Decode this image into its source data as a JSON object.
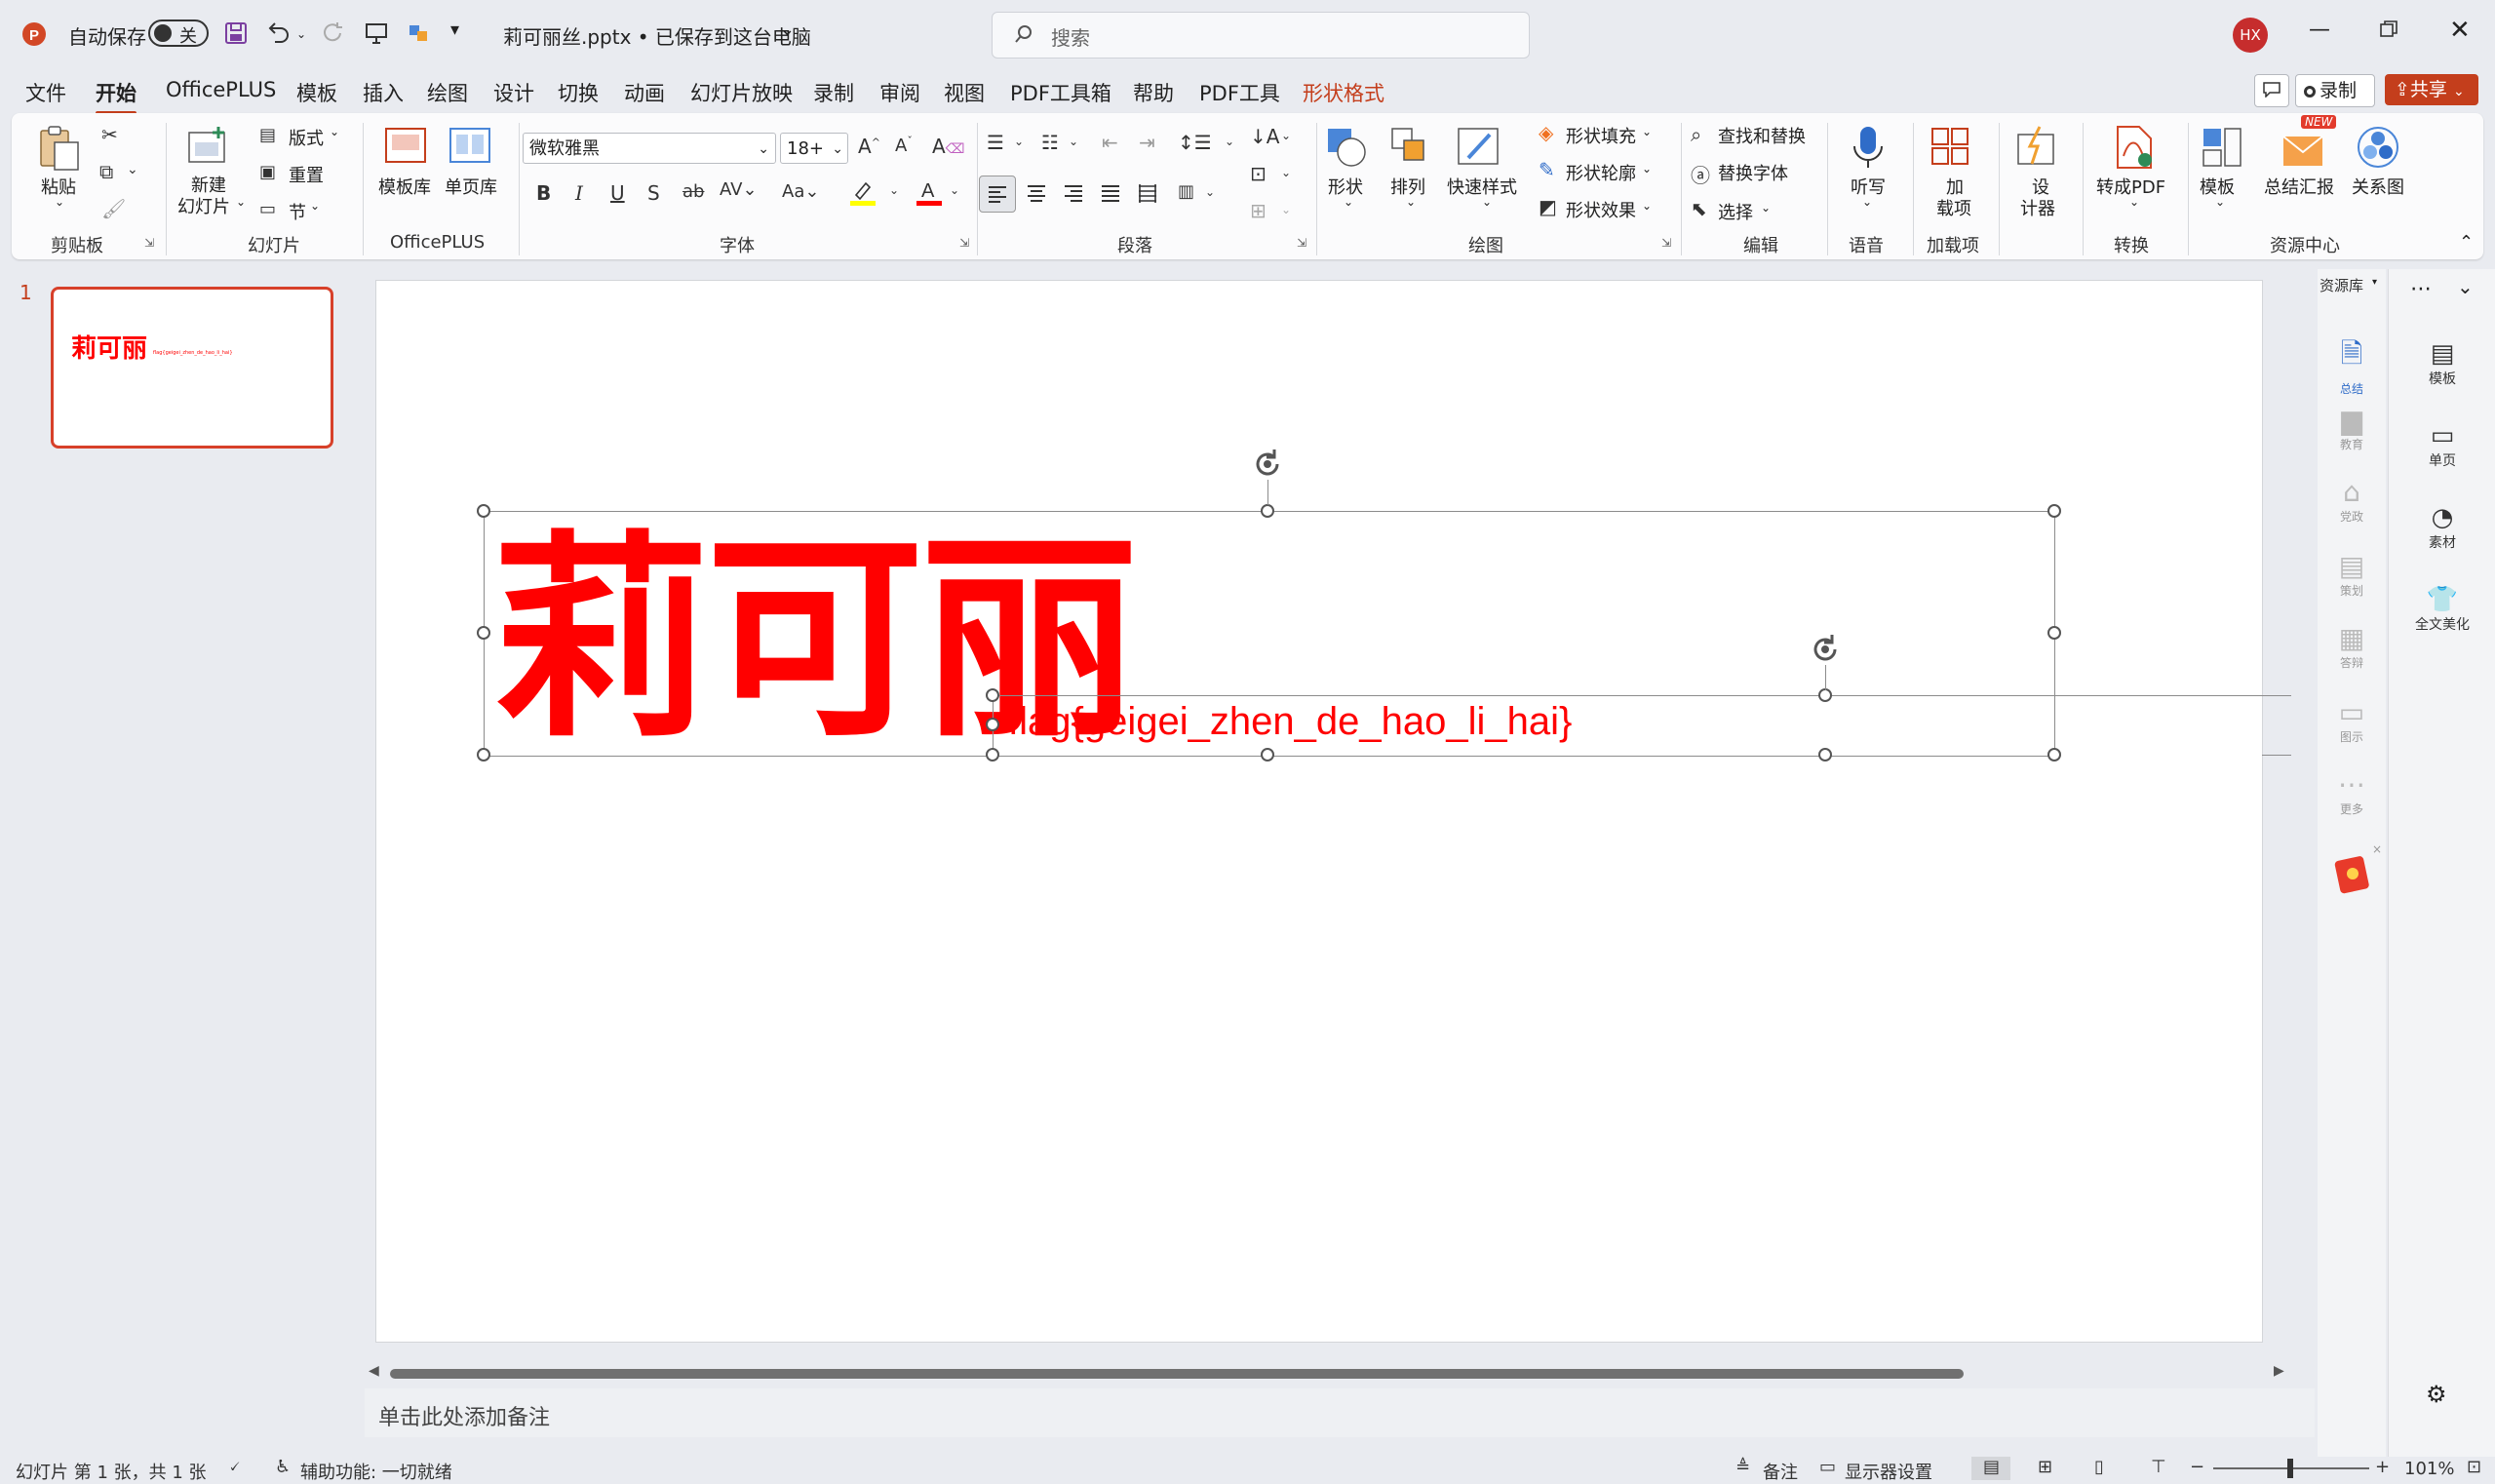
{
  "titlebar": {
    "autosave_label": "自动保存",
    "autosave_state": "关",
    "doc_title": "莉可丽丝.pptx • 已保存到这台电脑",
    "search_placeholder": "搜索",
    "user_initials": "HX"
  },
  "tabs": [
    "文件",
    "开始",
    "OfficePLUS",
    "模板",
    "插入",
    "绘图",
    "设计",
    "切换",
    "动画",
    "幻灯片放映",
    "录制",
    "审阅",
    "视图",
    "PDF工具箱",
    "帮助",
    "PDF工具",
    "形状格式"
  ],
  "tab_actions": {
    "record": "录制",
    "share": "共享"
  },
  "ribbon": {
    "clipboard": {
      "paste": "粘贴",
      "group": "剪贴板"
    },
    "slides": {
      "new_slide_1": "新建",
      "new_slide_2": "幻灯片",
      "layout": "版式",
      "reset": "重置",
      "section": "节",
      "group": "幻灯片"
    },
    "officeplus": {
      "template_lib": "模板库",
      "single_page": "单页库",
      "group": "OfficePLUS"
    },
    "font": {
      "font_name": "微软雅黑",
      "font_size": "18+",
      "group": "字体"
    },
    "paragraph": {
      "group": "段落"
    },
    "drawing": {
      "shapes": "形状",
      "arrange": "排列",
      "quick_styles": "快速样式",
      "shape_fill": "形状填充",
      "shape_outline": "形状轮廓",
      "shape_effects": "形状效果",
      "group": "绘图"
    },
    "editing": {
      "find_replace": "查找和替换",
      "replace_font": "替换字体",
      "select": "选择",
      "group": "编辑"
    },
    "voice": {
      "dictate": "听写",
      "group": "语音"
    },
    "addins": {
      "addins_1": "加",
      "addins_2": "载项",
      "group": "加载项"
    },
    "designer": {
      "d1": "设",
      "d2": "计器"
    },
    "convert": {
      "to_pdf": "转成PDF",
      "group": "转换"
    },
    "resources": {
      "template": "模板",
      "summary": "总结汇报",
      "diagram": "关系图",
      "group": "资源中心",
      "new_badge": "NEW"
    }
  },
  "thumbnails": [
    {
      "number": "1",
      "title": "莉可丽",
      "subtitle": "flag{geigei_zhen_de_hao_li_hai}"
    }
  ],
  "slide": {
    "title": "莉可丽",
    "subtitle": "flag{geigei_zhen_de_hao_li_hai}"
  },
  "resource_panel": {
    "header": "资源库",
    "items": [
      "总结",
      "教育",
      "党政",
      "策划",
      "答辩",
      "图示",
      "更多"
    ]
  },
  "right_panel": {
    "items": [
      "模板",
      "单页",
      "素材",
      "全文美化"
    ]
  },
  "notes_placeholder": "单击此处添加备注",
  "status": {
    "slide_info": "幻灯片 第 1 张，共 1 张",
    "accessibility": "辅助功能: 一切就绪",
    "notes": "备注",
    "display_settings": "显示器设置",
    "zoom": "101%"
  },
  "colors": {
    "accent": "#c43e1c",
    "title_red": "#ff0000",
    "share_bg": "#c43e1c"
  }
}
